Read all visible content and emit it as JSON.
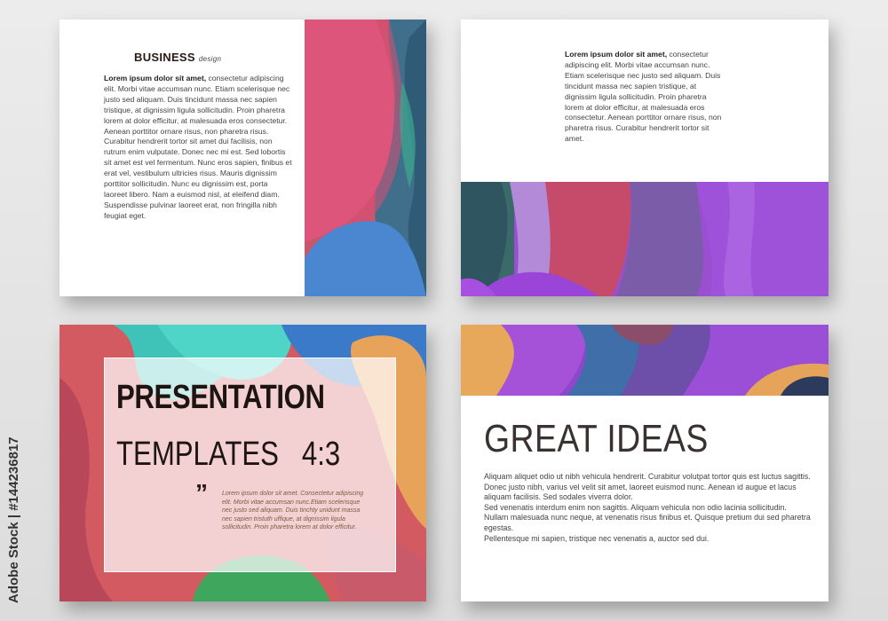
{
  "slide1": {
    "title": "BUSINESS",
    "title_suffix": "design",
    "lead": "Lorem ipsum dolor sit amet,",
    "body": " consectetur adipiscing elit. Morbi vitae accumsan nunc. Etiam scelerisque nec justo sed aliquam. Duis tincidunt massa nec sapien tristique, at dignissim ligula sollicitudin. Proin pharetra lorem at dolor efficitur, at malesuada eros consectetur. Aenean porttitor ornare risus, non pharetra risus. Curabitur hendrerit tortor sit amet dui facilisis, non rutrum enim vulputate. Donec nec mi est. Sed lobortis sit amet est vel fermentum. Nunc eros sapien, finibus et erat vel, vestibulum ultricies risus. Mauris dignissim porttitor sollicitudin. Nunc eu dignissim est, porta laoreet libero. Nam a euismod nisl, at eleifend diam. Suspendisse pulvinar laoreet erat, non fringilla nibh feugiat eget."
  },
  "slide2": {
    "lead": "Lorem ipsum dolor sit amet,",
    "body": " consectetur adipiscing elit. Morbi vitae accumsan nunc. Etiam scelerisque nec justo sed aliquam. Duis tincidunt massa nec sapien tristique, at dignissim ligula sollicitudin. Proin pharetra lorem at dolor efficitur, at malesuada eros consectetur. Aenean porttitor ornare risus, non pharetra risus. Curabitur hendrerit tortor sit amet."
  },
  "slide3": {
    "title_line1": "PRESENTATION",
    "title_line2": "TEMPLATES   4:3",
    "quote_mark": "”",
    "quote": "Lorem ipsum dolor sit amet. Consectetur adipiscing elit. Morbi vitae accumsan nunc.Etiam scelerisque nec justo sed aliquam. Duis tinchty unidunt massa nec sapien tristuth uffique, at dignissim ligula sollicitudin. Proin pharetra lorem at dolor efficitur."
  },
  "slide4": {
    "title": "GREAT IDEAS",
    "paragraphs": [
      "Aliquam aliquet odio ut nibh vehicula hendrerit. Curabitur volutpat tortor quis est luctus sagittis. Donec justo nibh, varius vel velit sit amet, laoreet euismod nunc. Aenean id augue et lacus aliquam facilisis. Sed sodales viverra dolor.",
      "Sed venenatis interdum enim non sagittis. Aliquam vehicula non odio lacinia sollicitudin.",
      "Nullam malesuada nunc neque, at venenatis risus finibus et. Quisque pretium dui sed pharetra egestas.",
      "Pellentesque mi sapien, tristique nec venenatis a, auctor sed dui."
    ]
  },
  "watermark": "Adobe Stock",
  "stock_id": "Adobe Stock | #144236817",
  "colors": {
    "pink": "#e05a7a",
    "red": "#c44a5e",
    "blue": "#4d8fd4",
    "teal": "#3fae9c",
    "purple": "#9a55d6",
    "violet": "#7a4ec4",
    "orange": "#e6a45a",
    "navy": "#2f4a6e",
    "green": "#3d9e5e"
  }
}
